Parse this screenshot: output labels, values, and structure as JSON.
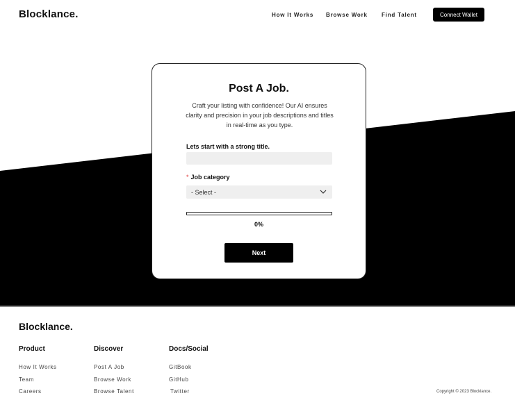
{
  "header": {
    "logo": "Blocklance.",
    "nav": [
      {
        "label": "How It Works"
      },
      {
        "label": "Browse Work"
      },
      {
        "label": "Find Talent"
      }
    ],
    "connect_wallet": "Connect Wallet"
  },
  "form": {
    "title": "Post A Job.",
    "description": "Craft your listing with confidence! Our AI ensures clarity and precision in your job descriptions and titles in real-time as you type.",
    "title_field": {
      "label": "Lets start with a strong title.",
      "value": "",
      "placeholder": ""
    },
    "category_field": {
      "required_marker": "*",
      "label": "Job category",
      "selected": "- Select -"
    },
    "progress": {
      "value": 0,
      "text": "0%"
    },
    "next_label": "Next"
  },
  "footer": {
    "logo": "Blocklance.",
    "columns": [
      {
        "heading": "Product",
        "links": [
          "How It Works",
          "Team",
          "Careers"
        ]
      },
      {
        "heading": "Discover",
        "links": [
          "Post A Job",
          "Browse Work",
          "Browse Talent"
        ]
      },
      {
        "heading": "Docs/Social",
        "links": [
          "GitBook",
          "GitHub",
          "Twitter"
        ]
      }
    ],
    "copyright": "Copyright © 2023 Blocklance."
  },
  "colors": {
    "background": "#ffffff",
    "accent": "#000000",
    "input_bg": "#efefef",
    "required": "#e23c3c"
  }
}
